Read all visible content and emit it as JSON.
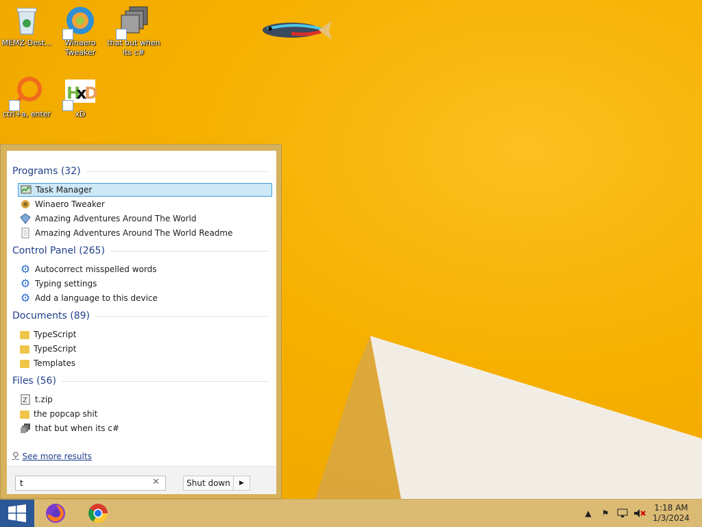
{
  "desktop": {
    "icons": [
      {
        "label": "MEMZ-Dest...",
        "icon": "recycle-bin-icon"
      },
      {
        "label": "Winaero Tweaker",
        "icon": "winaero-tweaker-icon"
      },
      {
        "label": "that but when its c#",
        "icon": "stacked-windows-icon"
      },
      {
        "label": "ctrl+a, enter",
        "icon": "magnifier-ring-icon"
      },
      {
        "label": "xD",
        "icon": "hxd-icon"
      }
    ]
  },
  "start_menu": {
    "groups": [
      {
        "title": "Programs (32)",
        "items": [
          {
            "label": "Task Manager",
            "icon": "task-manager-icon",
            "selected": true
          },
          {
            "label": "Winaero Tweaker",
            "icon": "winaero-tweaker-icon"
          },
          {
            "label": "Amazing Adventures Around The World",
            "icon": "gem-icon"
          },
          {
            "label": "Amazing Adventures Around The World Readme",
            "icon": "document-icon"
          }
        ]
      },
      {
        "title": "Control Panel (265)",
        "items": [
          {
            "label": "Autocorrect misspelled words",
            "icon": "gear-icon"
          },
          {
            "label": "Typing settings",
            "icon": "gear-icon"
          },
          {
            "label": "Add a language to this device",
            "icon": "gear-icon"
          }
        ]
      },
      {
        "title": "Documents (89)",
        "items": [
          {
            "label": "TypeScript",
            "icon": "folder-icon"
          },
          {
            "label": "TypeScript",
            "icon": "folder-icon"
          },
          {
            "label": "Templates",
            "icon": "folder-icon"
          }
        ]
      },
      {
        "title": "Files (56)",
        "items": [
          {
            "label": "t.zip",
            "icon": "zip-icon"
          },
          {
            "label": "the popcap shit",
            "icon": "folder-icon"
          },
          {
            "label": "that but when its c#",
            "icon": "stacked-windows-icon"
          }
        ]
      }
    ],
    "see_more": "See more results",
    "search": {
      "value": "t",
      "clear_glyph": "✕"
    },
    "shutdown_label": "Shut down",
    "shutdown_arrow": "▶"
  },
  "taskbar": {
    "apps": [
      {
        "name": "firefox",
        "icon": "firefox-icon"
      },
      {
        "name": "chrome",
        "icon": "chrome-icon"
      }
    ],
    "tray": {
      "time": "1:18 AM",
      "date": "1/3/2024"
    }
  },
  "colors": {
    "wallpaper": "#f6b000",
    "start_menu_frame": "#d6b25c",
    "accent": "#2b5797",
    "selection_bg": "#cde8f7",
    "selection_border": "#3f9bd8",
    "group_title": "#1e3f8a"
  }
}
